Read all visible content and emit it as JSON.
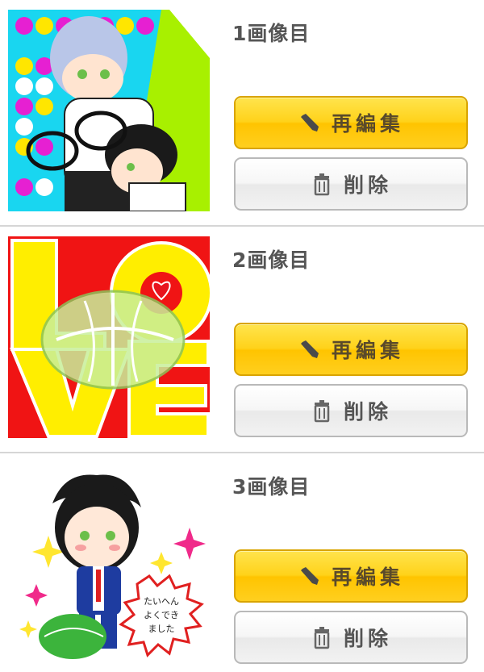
{
  "items": [
    {
      "title": "1画像目",
      "edit_label": "再編集",
      "delete_label": "削除"
    },
    {
      "title": "2画像目",
      "edit_label": "再編集",
      "delete_label": "削除"
    },
    {
      "title": "3画像目",
      "edit_label": "再編集",
      "delete_label": "削除",
      "speech_text": "たいへんよくできました"
    }
  ],
  "images": {
    "image1": {
      "colors": {
        "dots_bg": "#19d6f0",
        "dot_magenta": "#e620d2",
        "dot_yellow": "#ffe600",
        "dot_white": "#ffffff",
        "green": "#a8f000"
      }
    },
    "image2": {
      "colors": {
        "red": "#f01414",
        "yellow": "#ffee00",
        "white": "#ffffff",
        "cabbage": "#c8ef9a",
        "heart": "#e8141e"
      }
    },
    "image3": {
      "colors": {
        "sparkle_pink": "#f02a8a",
        "sparkle_yellow": "#ffe630",
        "suit": "#1e3ca0",
        "cabbage": "#3cb43c"
      }
    }
  },
  "icons": {
    "edit": "pencil-icon",
    "delete": "trash-icon"
  }
}
